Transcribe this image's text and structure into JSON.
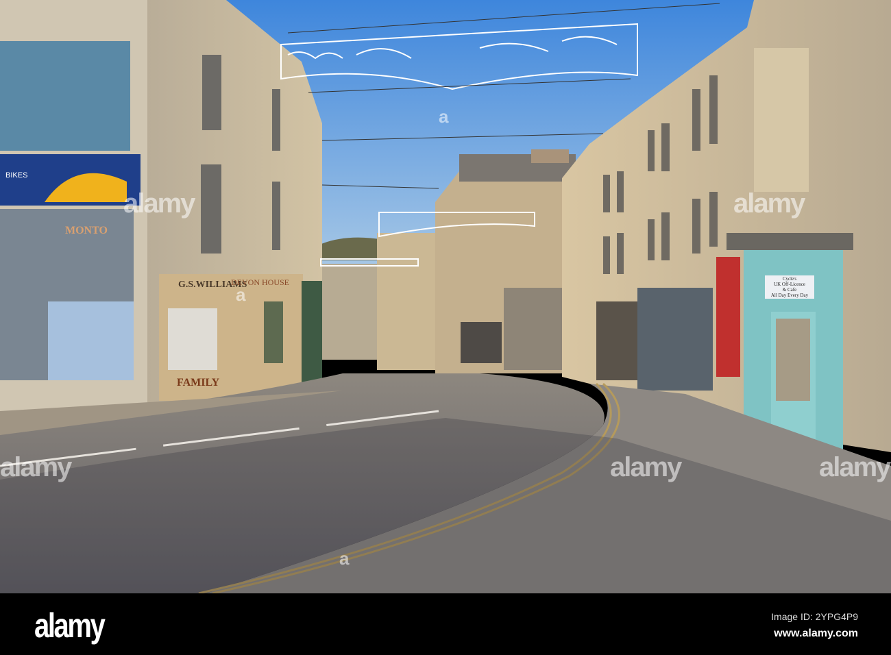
{
  "photo": {
    "signs": {
      "bike_shop": "BIKES",
      "bike_shop_window": "MONTO",
      "williams": "G.S.WILLIAMS",
      "devon_house": "DEVON HOUSE",
      "family": "FAMILY",
      "cafe_lines": [
        "Cycle's",
        "UK Off-Licence",
        "& Cafe",
        "All Day Every Day"
      ]
    },
    "colors": {
      "sky": "#5d9ae0",
      "stone": "#c9b998",
      "road": "#6f6c70",
      "door": "#7fc3c4",
      "bike_blue": "#1f3f8a",
      "bike_yellow": "#f0b21c"
    }
  },
  "watermark": {
    "text": "alamy",
    "mark": "a"
  },
  "footer": {
    "logo": "alamy",
    "image_id": "Image ID: 2YPG4P9",
    "site": "www.alamy.com"
  }
}
